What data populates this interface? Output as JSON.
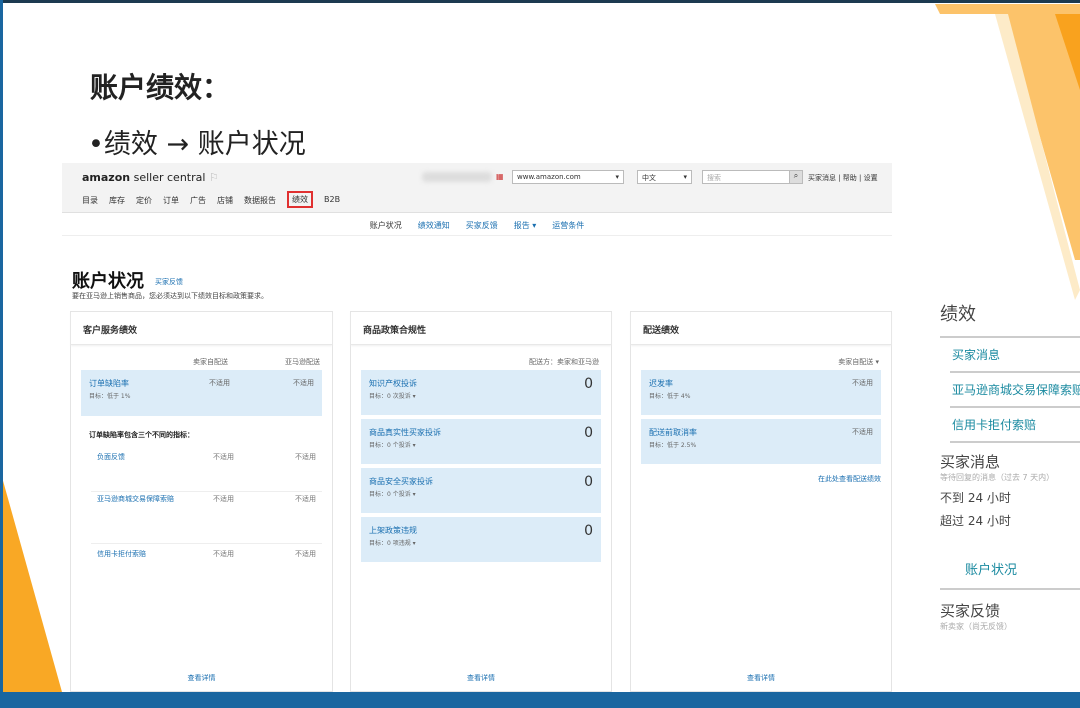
{
  "slide": {
    "title": "账户绩效：",
    "bullet": "•绩效 → 账户状况"
  },
  "header": {
    "logo_brand": "amazon",
    "logo_text": "seller central",
    "marketplace": "www.amazon.com",
    "language": "中文",
    "search_placeholder": "搜索",
    "links": "买家消息 | 帮助 | 设置",
    "nav": [
      "目录",
      "库存",
      "定价",
      "订单",
      "广告",
      "店铺",
      "数据报告",
      "绩效",
      "B2B"
    ],
    "nav_selected": "绩效"
  },
  "subnav": [
    "账户状况",
    "绩效通知",
    "买家反馈",
    "报告 ▾",
    "运营条件"
  ],
  "page": {
    "title": "账户状况",
    "title_link": "买家反馈",
    "description": "要在亚马逊上销售商品，您必须达到以下绩效目标和政策要求。"
  },
  "cards": [
    {
      "title": "客户服务绩效",
      "cols": [
        "卖家自配送",
        "亚马逊配送"
      ],
      "main": {
        "label": "订单缺陷率",
        "target": "目标：低于 1%",
        "a": "不适用",
        "b": "不适用"
      },
      "subhead": "订单缺陷率包含三个不同的指标：",
      "items": [
        {
          "label": "负面反馈",
          "a": "不适用",
          "b": "不适用"
        },
        {
          "label": "亚马逊商城交易保障索赔",
          "a": "不适用",
          "b": "不适用"
        },
        {
          "label": "信用卡拒付索赔",
          "a": "不适用",
          "b": "不适用"
        }
      ],
      "more": "查看详情"
    },
    {
      "title": "商品政策合规性",
      "filter": "配送方：卖家和亚马逊",
      "rows": [
        {
          "label": "知识产权投诉",
          "target": "目标：0 次投诉 ▾",
          "value": "0"
        },
        {
          "label": "商品真实性买家投诉",
          "target": "目标：0 个投诉 ▾",
          "value": "0"
        },
        {
          "label": "商品安全买家投诉",
          "target": "目标：0 个投诉 ▾",
          "value": "0"
        },
        {
          "label": "上架政策违规",
          "target": "目标：0 项违规 ▾",
          "value": "0"
        }
      ],
      "more": "查看详情"
    },
    {
      "title": "配送绩效",
      "filter": "卖家自配送 ▾",
      "rows": [
        {
          "label": "迟发率",
          "target": "目标：低于 4%",
          "value": "不适用"
        },
        {
          "label": "配送前取消率",
          "target": "目标：低于 2.5%",
          "value": "不适用"
        }
      ],
      "link": "在此处查看配送绩效",
      "more": "查看详情"
    }
  ],
  "right_panel": {
    "title": "绩效",
    "links": [
      "买家消息",
      "亚马逊商城交易保障索赔",
      "信用卡拒付索赔"
    ],
    "messages_title": "买家消息",
    "messages_sub": "等待回复的消息（过去 7 天内）",
    "lt24": "不到 24 小时",
    "gt24": "超过 24 小时",
    "account_link": "账户状况",
    "feedback_title": "买家反馈",
    "feedback_sub": "新卖家（尚无反馈）"
  },
  "colors": {
    "accent_orange": "#f9a825",
    "link_blue": "#1a6fb0",
    "row_bg": "#dcecf8",
    "slide_blue": "#1a66a0"
  }
}
